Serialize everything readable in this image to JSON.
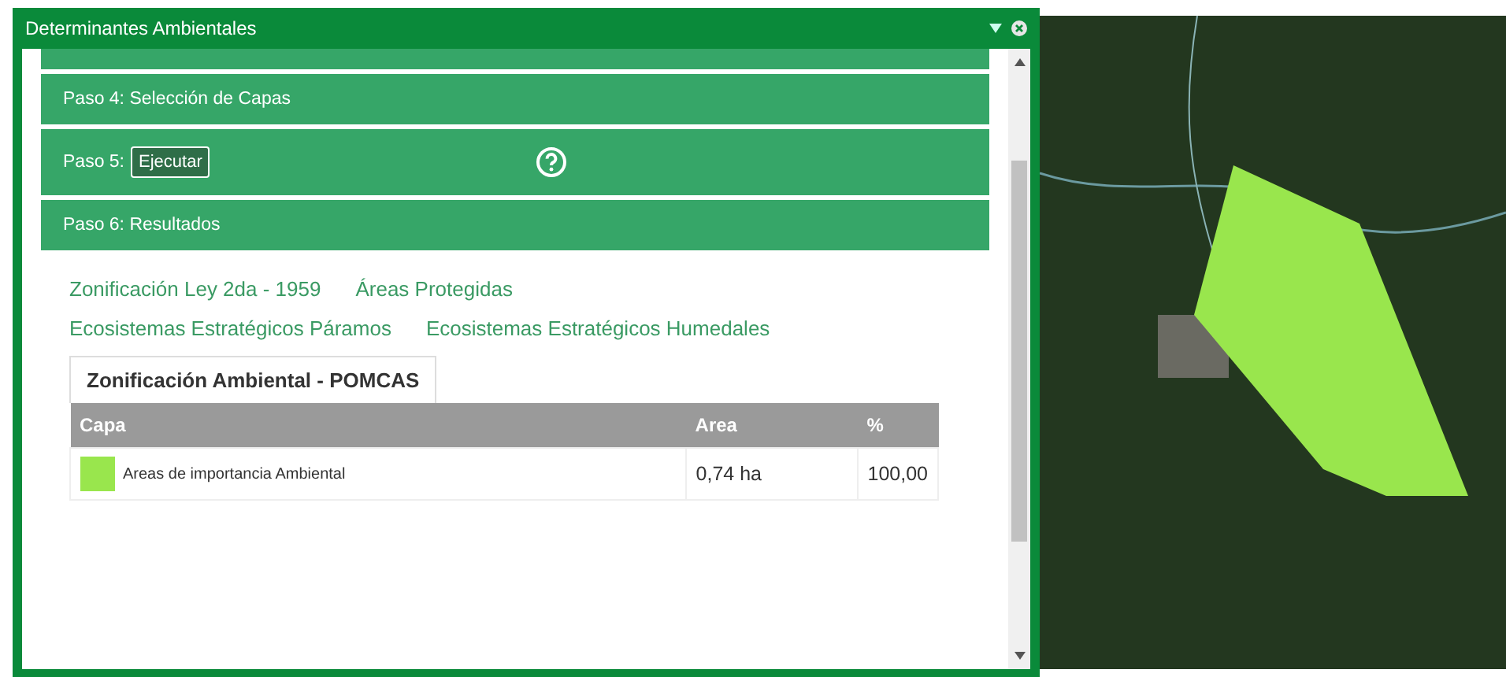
{
  "window": {
    "title": "Determinantes Ambientales"
  },
  "steps": [
    {
      "kind": "cut"
    },
    {
      "kind": "plain",
      "label": "Paso 4: Selección de Capas"
    },
    {
      "kind": "action",
      "label": "Paso 5:",
      "button": "Ejecutar"
    },
    {
      "kind": "plain",
      "label": "Paso 6: Resultados"
    }
  ],
  "tabs": [
    {
      "label": "Zonificación Ley 2da - 1959",
      "selected": false
    },
    {
      "label": "Áreas Protegidas",
      "selected": false
    },
    {
      "label": "Ecosistemas Estratégicos Páramos",
      "selected": false
    },
    {
      "label": "Ecosistemas Estratégicos Humedales",
      "selected": false
    },
    {
      "label": "Zonificación Ambiental - POMCAS",
      "selected": true
    }
  ],
  "table": {
    "columns": [
      "Capa",
      "Area",
      "%"
    ],
    "rows": [
      {
        "color": "#99e64d",
        "capa": "Areas de importancia Ambiental",
        "area": "0,74 ha",
        "percent": "100,00"
      }
    ]
  }
}
